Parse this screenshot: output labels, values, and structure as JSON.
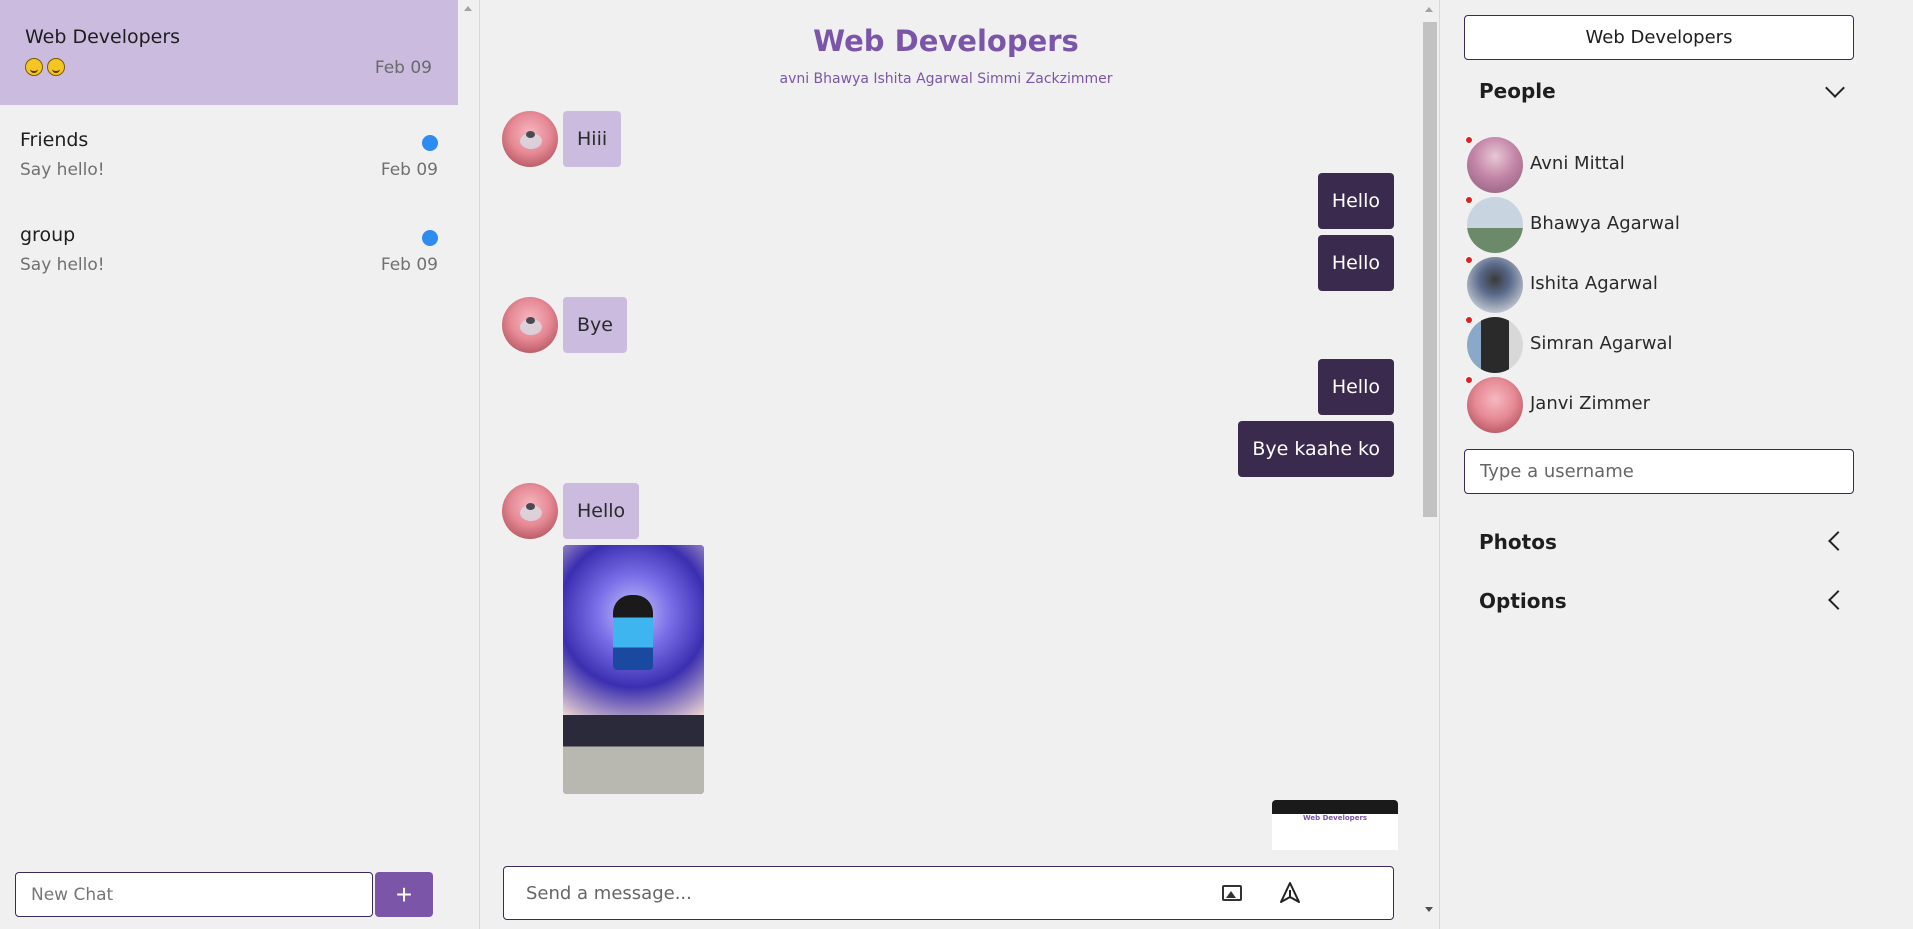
{
  "sidebar": {
    "chats": [
      {
        "name": "Web Developers",
        "preview": "😆😆",
        "date": "Feb 09",
        "active": true,
        "unread": false
      },
      {
        "name": "Friends",
        "preview": "Say hello!",
        "date": "Feb 09",
        "active": false,
        "unread": true
      },
      {
        "name": "group",
        "preview": "Say hello!",
        "date": "Feb 09",
        "active": false,
        "unread": true
      }
    ],
    "new_chat_placeholder": "New Chat",
    "add_button_label": "+"
  },
  "conversation": {
    "title": "Web Developers",
    "members": "avni Bhawya Ishita Agarwal Simmi Zackzimmer",
    "messages": [
      {
        "direction": "in",
        "text": "Hiii"
      },
      {
        "direction": "out",
        "text": "Hello"
      },
      {
        "direction": "out",
        "text": "Hello"
      },
      {
        "direction": "in",
        "text": "Bye"
      },
      {
        "direction": "out",
        "text": "Hello"
      },
      {
        "direction": "out",
        "text": "Bye kaahe ko"
      },
      {
        "direction": "in",
        "text": "Hello"
      }
    ],
    "thumbnail_title": "Web Developers",
    "composer_placeholder": "Send a message..."
  },
  "details": {
    "group_name": "Web Developers",
    "people_heading": "People",
    "people": [
      {
        "name": "Avni Mittal"
      },
      {
        "name": "Bhawya Agarwal"
      },
      {
        "name": "Ishita Agarwal"
      },
      {
        "name": "Simran Agarwal"
      },
      {
        "name": "Janvi Zimmer"
      }
    ],
    "username_placeholder": "Type a username",
    "photos_heading": "Photos",
    "options_heading": "Options"
  },
  "colors": {
    "accent": "#7b55a8",
    "active_chat": "#cabbdf",
    "outgoing_bubble": "#3a2a4e",
    "incoming_bubble": "#cabbdf",
    "unread_dot": "#2d8cf0",
    "online_dot": "#e02020"
  }
}
